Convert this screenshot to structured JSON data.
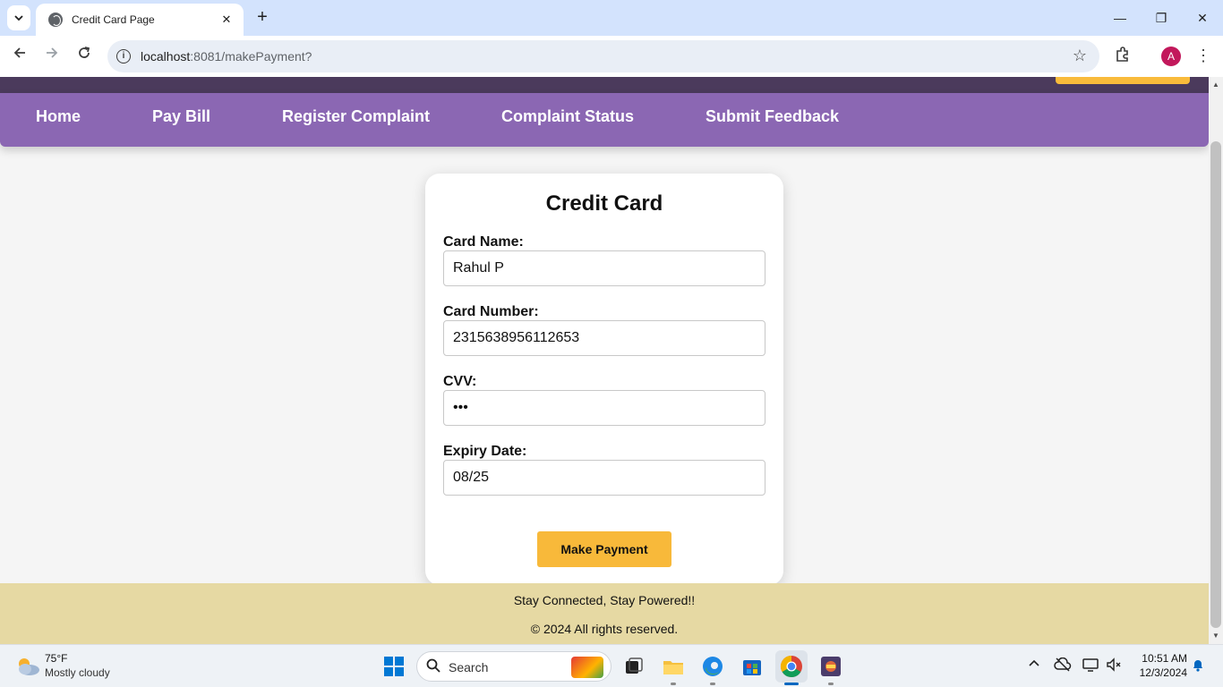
{
  "browser": {
    "tab_title": "Credit Card Page",
    "tab_close": "✕",
    "new_tab": "+",
    "url_host": "localhost",
    "url_rest": ":8081/makePayment?",
    "profile_initial": "A",
    "window_controls": [
      "—",
      "❐",
      "✕"
    ]
  },
  "navbar": {
    "items": [
      "Home",
      "Pay Bill",
      "Register Complaint",
      "Complaint Status",
      "Submit Feedback"
    ]
  },
  "form": {
    "title": "Credit Card",
    "fields": [
      {
        "label": "Card Name:",
        "value": "Rahul P"
      },
      {
        "label": "Card Number:",
        "value": "2315638956112653"
      },
      {
        "label": "CVV:",
        "value": "•••"
      },
      {
        "label": "Expiry Date:",
        "value": "08/25"
      }
    ],
    "submit_label": "Make Payment"
  },
  "footer": {
    "tagline": "Stay Connected, Stay Powered!!",
    "copyright": "© 2024 All rights reserved."
  },
  "taskbar": {
    "weather_temp": "75°F",
    "weather_desc": "Mostly cloudy",
    "search_placeholder": "Search",
    "time": "10:51 AM",
    "date": "12/3/2024"
  },
  "colors": {
    "nav_purple": "#8b67b3",
    "header_dark": "#4b3a5c",
    "accent_yellow": "#f8b93a",
    "footer_bg": "#e6d9a3"
  },
  "icons": [
    "tab-list-icon",
    "globe-icon",
    "back-icon",
    "forward-icon",
    "reload-icon",
    "site-info-icon",
    "star-icon",
    "extensions-icon",
    "menu-icon",
    "windows-start-icon",
    "search-icon",
    "task-view-icon",
    "file-explorer-icon",
    "edge-icon",
    "store-icon",
    "chrome-icon",
    "app-icon",
    "chevron-up-icon",
    "cloud-off-icon",
    "display-icon",
    "volume-icon",
    "bell-icon"
  ]
}
